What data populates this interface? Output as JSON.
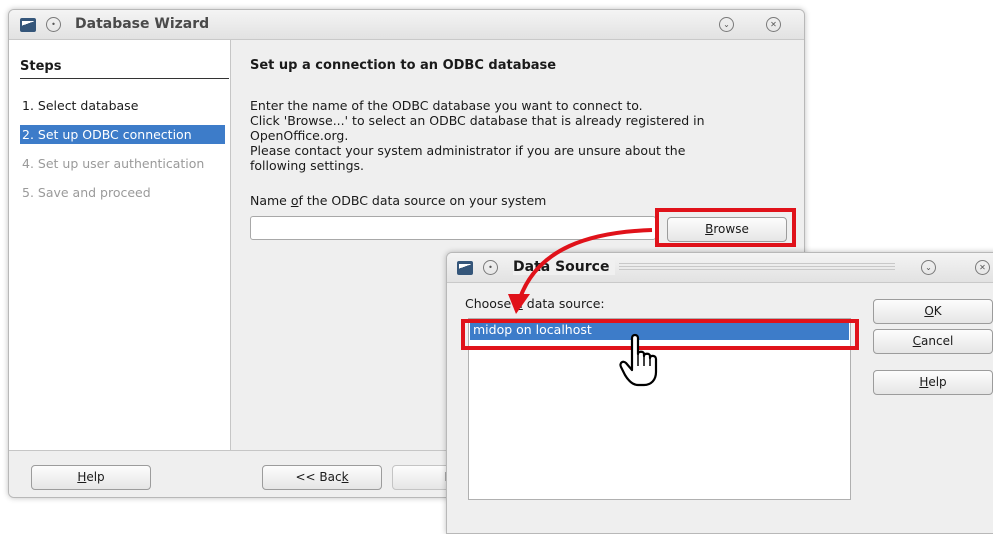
{
  "wizard": {
    "title": "Database Wizard",
    "steps_heading": "Steps",
    "steps": [
      {
        "label": "1. Select database",
        "state": "done"
      },
      {
        "label": "2. Set up ODBC connection",
        "state": "current"
      },
      {
        "label": "4. Set up user authentication",
        "state": "pending"
      },
      {
        "label": "5. Save and proceed",
        "state": "pending"
      }
    ],
    "heading": "Set up a connection to an ODBC database",
    "description": [
      "Enter the name of the ODBC database you want to connect to.",
      "Click 'Browse...' to select an ODBC database that is already registered in",
      "OpenOffice.org.",
      "Please contact your system administrator if you are unsure about the",
      "following settings."
    ],
    "field_label": {
      "before": "Name ",
      "mnemonic": "o",
      "after": "f the ODBC data source on your system"
    },
    "field_value": "",
    "browse_button": {
      "before": "",
      "mnemonic": "B",
      "after": "rowse"
    },
    "help_button": {
      "before": "",
      "mnemonic": "H",
      "after": "elp"
    },
    "back_button": {
      "before": "<< Bac",
      "mnemonic": "k",
      "after": ""
    },
    "next_button": {
      "before": "Ne",
      "mnemonic": "",
      "after": ""
    }
  },
  "data_source": {
    "title": "Data Source",
    "choose_label": {
      "before": "Choose ",
      "mnemonic": "a",
      "after": " data source:"
    },
    "items": [
      "midop on localhost"
    ],
    "selected_index": 0,
    "ok_button": {
      "before": "",
      "mnemonic": "O",
      "after": "K"
    },
    "cancel_button": {
      "before": "",
      "mnemonic": "C",
      "after": "ancel"
    },
    "help_button": {
      "before": "",
      "mnemonic": "H",
      "after": "elp"
    }
  },
  "colors": {
    "highlight": "#3d7cc9",
    "annotation": "#e0121a"
  }
}
